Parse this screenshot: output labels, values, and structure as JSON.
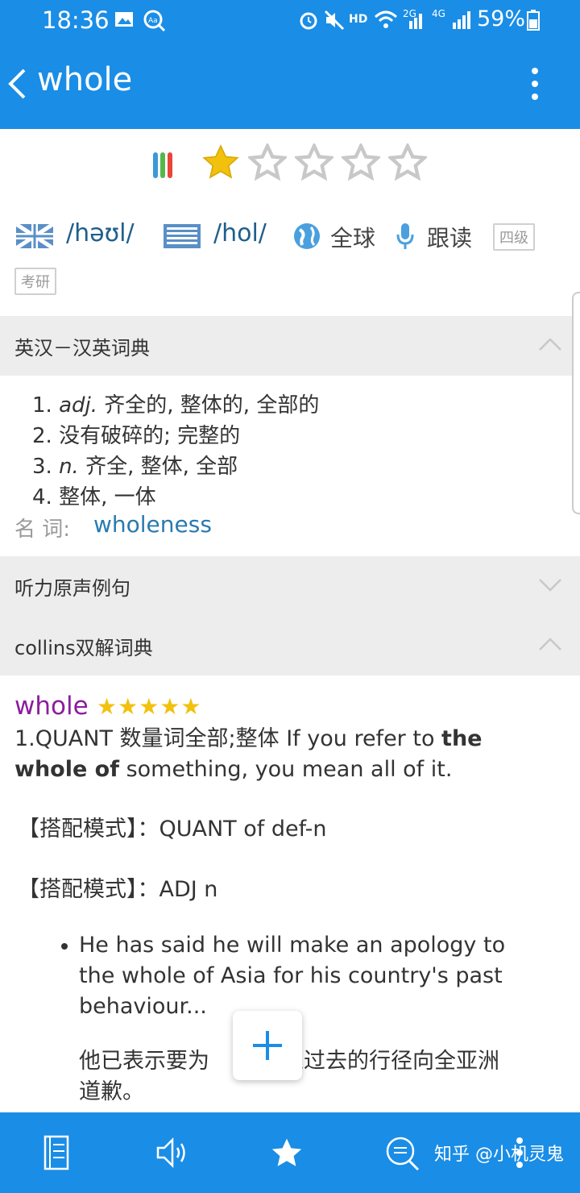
{
  "status_bar": {
    "time": "18:36",
    "battery": "59%",
    "signal_2g": "2G",
    "signal_4g": "4G",
    "hd": "HD"
  },
  "header": {
    "title": "whole",
    "back_icon": "chevron-left-icon",
    "more_icon": "more-vertical-icon"
  },
  "rating": {
    "filled": 1,
    "total": 5
  },
  "pronunciation": {
    "uk": "/həʊl/",
    "us": "/hol/",
    "global_label": "全球",
    "readalong_label": "跟读",
    "tags": [
      "四级",
      "考研"
    ]
  },
  "sections": {
    "ec_dict": {
      "title": "英汉－汉英词典",
      "definitions": [
        {
          "num": "1.",
          "pos": "adj.",
          "text": "齐全的, 整体的, 全部的"
        },
        {
          "num": "2.",
          "pos": "",
          "text": "没有破碎的; 完整的"
        },
        {
          "num": "3.",
          "pos": "n.",
          "text": "齐全, 整体, 全部"
        },
        {
          "num": "4.",
          "pos": "",
          "text": "整体, 一体"
        }
      ],
      "noun_label": "名 词:",
      "noun_value": "wholeness"
    },
    "listening": {
      "title": "听力原声例句"
    },
    "collins": {
      "title": "collins双解词典",
      "word": "whole",
      "stars": "★★★★★",
      "sense_prefix": "1.QUANT 数量词全部;整体 If you refer to ",
      "sense_bold1": "the",
      "sense_bold2": "whole of",
      "sense_suffix": " something, you mean all of it.",
      "pattern1": "【搭配模式】：QUANT of def-n",
      "pattern2": "【搭配模式】：ADJ n",
      "example_en_1": "He has said he will make an apology to",
      "example_en_2": "the whole of Asia for his country's past",
      "example_en_3": "behaviour...",
      "example_zh_1a": "他已表示要为",
      "example_zh_1b": "家过去的行径向全亚洲",
      "example_zh_2": "道歉。"
    }
  },
  "fab": {
    "icon": "plus-icon"
  },
  "bottom_bar": {
    "icons": [
      "notebook-icon",
      "speaker-icon",
      "star-icon",
      "search-list-icon",
      "more-vertical-icon"
    ],
    "watermark": "知乎 @小机灵鬼"
  },
  "colors": {
    "primary": "#1a8de6",
    "star": "#f2c10e",
    "headword": "#8b1e9e",
    "link": "#2a7ab0"
  }
}
